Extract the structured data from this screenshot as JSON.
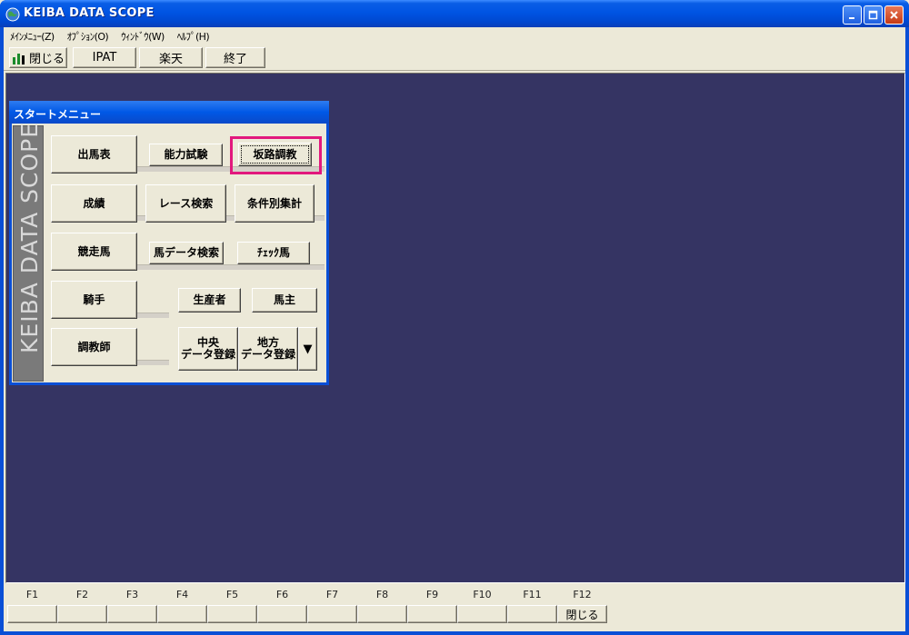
{
  "window": {
    "title": "KEIBA DATA SCOPE",
    "colors": {
      "titlebar": "#0054e3",
      "mdi_background": "#353463",
      "highlight": "#e2187d"
    }
  },
  "menubar": [
    {
      "label": "ﾒｲﾝﾒﾆｭｰ(Z)"
    },
    {
      "label": "ｵﾌﾟｼｮﾝ(O)"
    },
    {
      "label": "ｳｨﾝﾄﾞｳ(W)"
    },
    {
      "label": "ﾍﾙﾌﾟ(H)"
    }
  ],
  "toolbar": {
    "close_label": "閉じる",
    "ipat_label": "IPAT",
    "rakuten_label": "楽天",
    "exit_label": "終了"
  },
  "start_menu": {
    "title": "スタートメニュー",
    "brand": "KEIBA DATA SCOPE",
    "buttons": {
      "shutsubahyo": "出馬表",
      "noryoku_shiken": "能力試験",
      "sakaro_chokyo": "坂路調教",
      "seiseki": "成績",
      "race_kensaku": "レース検索",
      "joken_shukei": "条件別集計",
      "kyosoba": "競走馬",
      "uma_data_kensaku": "馬データ検索",
      "check_uma": "ﾁｪｯｸ馬",
      "kishu": "騎手",
      "seisansha": "生産者",
      "banushi": "馬主",
      "chokyoshi": "調教師",
      "chuo_line1": "中央",
      "chuo_line2": "データ登録",
      "chiho_line1": "地方",
      "chiho_line2": "データ登録",
      "dropdown_glyph": "▼"
    }
  },
  "function_keys": [
    {
      "key": "F1",
      "action": ""
    },
    {
      "key": "F2",
      "action": ""
    },
    {
      "key": "F3",
      "action": ""
    },
    {
      "key": "F4",
      "action": ""
    },
    {
      "key": "F5",
      "action": ""
    },
    {
      "key": "F6",
      "action": ""
    },
    {
      "key": "F7",
      "action": ""
    },
    {
      "key": "F8",
      "action": ""
    },
    {
      "key": "F9",
      "action": ""
    },
    {
      "key": "F10",
      "action": ""
    },
    {
      "key": "F11",
      "action": ""
    },
    {
      "key": "F12",
      "action": "閉じる"
    }
  ],
  "icons": {
    "app": "globe-icon",
    "toolbar_close": "bar-chart-icon",
    "minimize": "minimize-icon",
    "maximize": "maximize-icon",
    "close": "close-icon"
  }
}
